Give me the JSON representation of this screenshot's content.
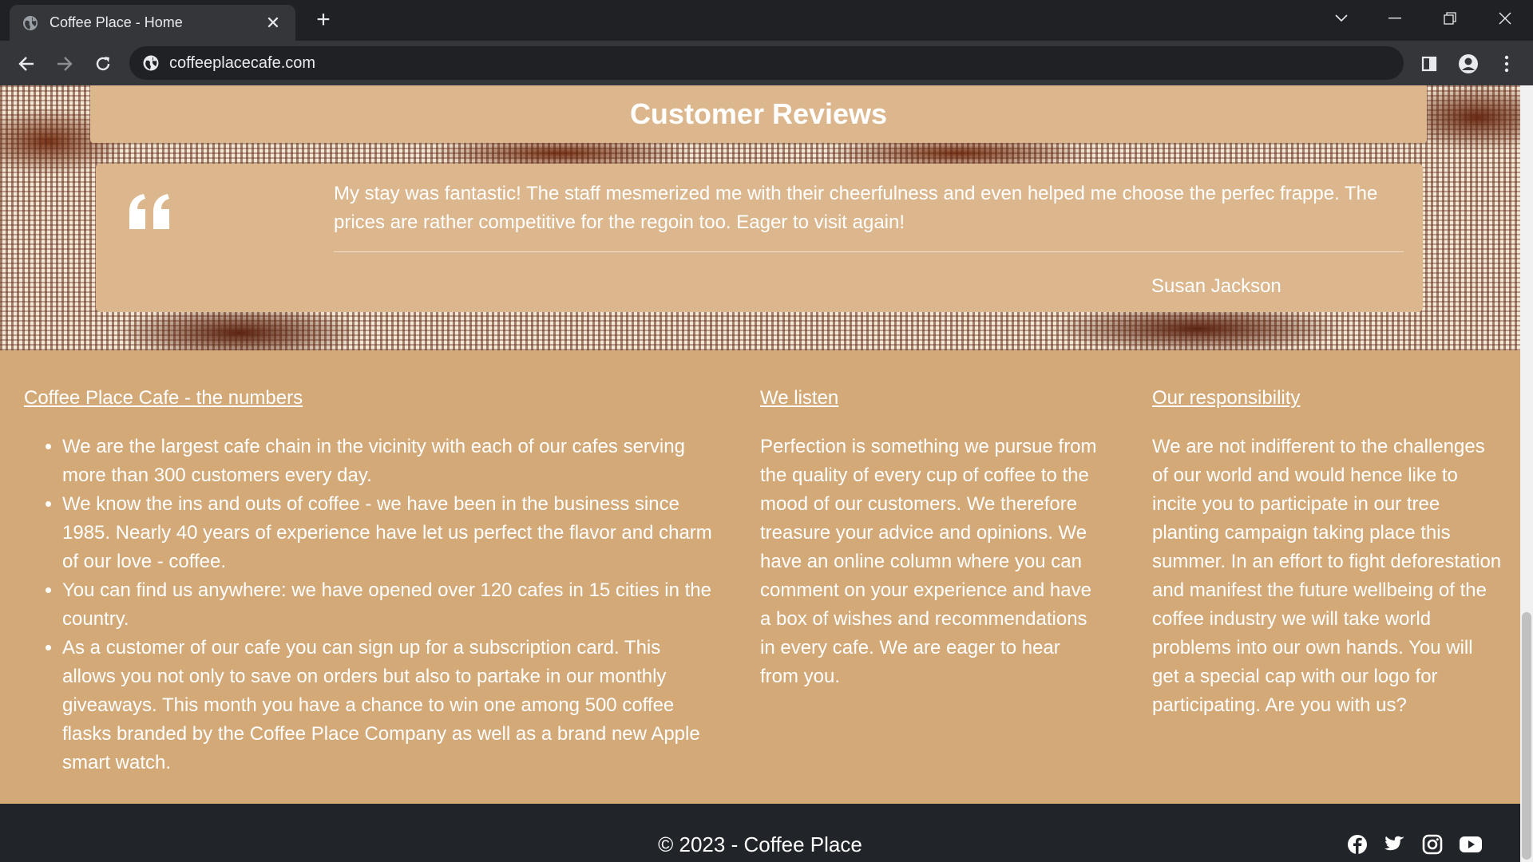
{
  "browser": {
    "tab_title": "Coffee Place - Home",
    "tab_close": "✕",
    "new_tab": "+",
    "url": "coffeeplacecafe.com"
  },
  "reviews": {
    "title": "Customer Reviews",
    "quote_text": "My stay was fantastic! The staff mesmerized me with their cheerfulness and even helped me choose the perfec frappe. The prices are rather competitive for the regoin too. Eager to visit again!",
    "author": "Susan Jackson"
  },
  "info": {
    "numbers": {
      "heading": "Coffee Place Cafe - the numbers",
      "items": [
        "We are the largest cafe chain in the vicinity with each of our cafes serving more than 300 customers every day.",
        "We know the ins and outs of coffee - we have been in the business since 1985. Nearly 40 years of experience have let us perfect the flavor and charm of our love - coffee.",
        "You can find us anywhere: we have opened over 120 cafes in 15 cities in the country.",
        "As a customer of our cafe you can sign up for a subscription card. This allows you not only to save on orders but also to partake in our monthly giveaways. This month you have a chance to win one among 500 coffee flasks branded by the Coffee Place Company as well as a brand new Apple smart watch."
      ]
    },
    "listen": {
      "heading": "We listen",
      "text": "Perfection is something we pursue from the quality of every cup of coffee to the mood of our customers. We therefore treasure your advice and opinions. We have an online column where you can comment on your experience and have a box of wishes and recommendations in every cafe. We are eager to hear from you."
    },
    "responsibility": {
      "heading": "Our responsibility",
      "text": "We are not indifferent to the challenges of our world and would hence like to incite you to participate in our tree planting campaign taking place this summer. In an effort to fight deforestation and manifest the future wellbeing of the coffee industry we will take world problems into our own hands. You will get a special cap with our logo for participating. Are you with us?"
    }
  },
  "footer": {
    "copyright": "© 2023 - Coffee Place",
    "social": [
      "facebook-icon",
      "twitter-icon",
      "instagram-icon",
      "youtube-icon"
    ]
  }
}
